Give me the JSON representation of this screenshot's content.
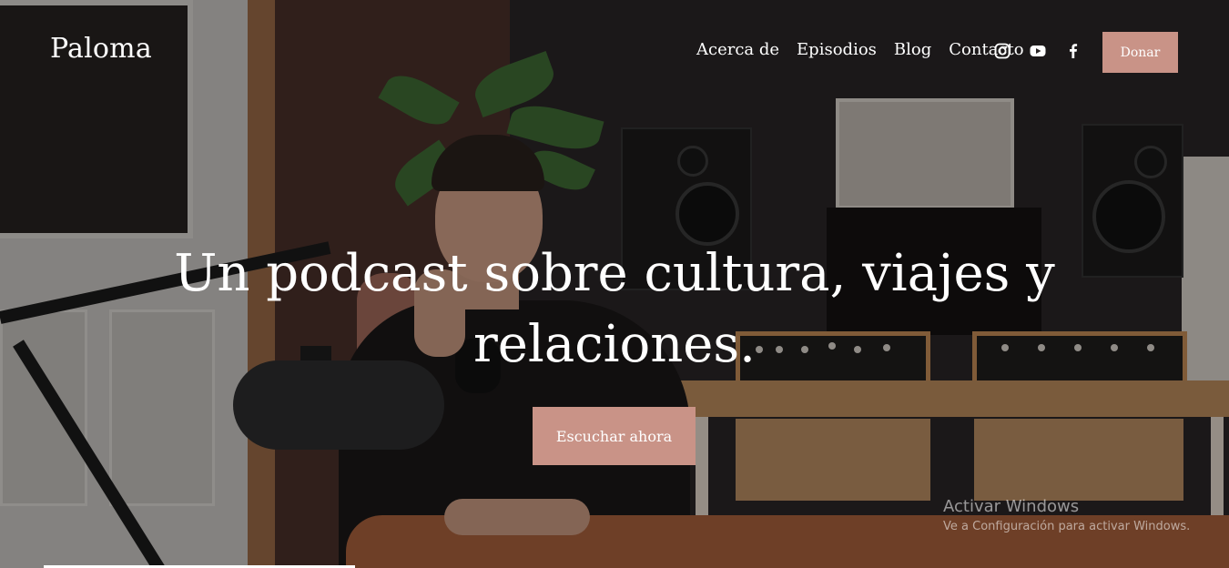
{
  "header": {
    "logo": "Paloma",
    "nav": [
      {
        "label": "Acerca de"
      },
      {
        "label": "Episodios"
      },
      {
        "label": "Blog"
      },
      {
        "label": "Contacto"
      }
    ],
    "social_icons": [
      "instagram-icon",
      "youtube-icon",
      "facebook-icon"
    ],
    "donate_label": "Donar"
  },
  "hero": {
    "title": "Un podcast sobre cultura, viajes y relaciones.",
    "cta_label": "Escuchar ahora",
    "background": "photo of a man sitting at a desk in a podcast recording studio"
  },
  "watermark": {
    "title": "Activar Windows",
    "subtitle": "Ve a Configuración para activar Windows."
  },
  "colors": {
    "accent": "#c99387",
    "text": "#ffffff"
  }
}
